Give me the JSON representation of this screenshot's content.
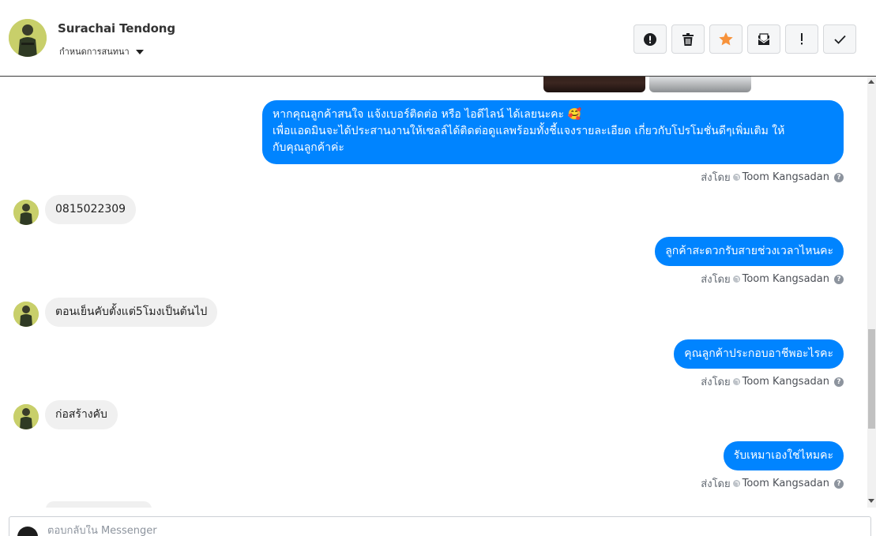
{
  "header": {
    "contact_name": "Surachai Tendong",
    "conversation_assign_label": "กำหนดการสนทนา",
    "toolbar": [
      {
        "name": "report-spam-button",
        "icon": "exclamation-circle-icon"
      },
      {
        "name": "delete-button",
        "icon": "trash-icon"
      },
      {
        "name": "star-button",
        "icon": "star-icon"
      },
      {
        "name": "archive-button",
        "icon": "archive-icon"
      },
      {
        "name": "mark-important-button",
        "icon": "exclamation-icon"
      },
      {
        "name": "mark-done-button",
        "icon": "check-icon"
      }
    ]
  },
  "messages": [
    {
      "direction": "out",
      "text_lines": [
        "หากคุณลูกค้าสนใจ แจ้งเบอร์ติดต่อ หรือ ไอดีไลน์ ได้เลยนะคะ 🥰",
        "เพื่อแอดมินจะได้ประสานงานให้เซลล์ได้ติดต่อดูแลพร้อมทั้งชี้แจงรายละเอียด เกี่ยวกับโปรโมชั่นดีๆเพิ่มเติม ให้",
        "กับคุณลูกค้าค่ะ"
      ],
      "sent_by_label": "ส่งโดย",
      "sender": "Toom Kangsadan"
    },
    {
      "direction": "in",
      "text": "0815022309"
    },
    {
      "direction": "out",
      "text": "ลูกค้าสะดวกรับสายช่วงเวลาไหนคะ",
      "sent_by_label": "ส่งโดย",
      "sender": "Toom Kangsadan"
    },
    {
      "direction": "in",
      "text": "ตอนเย็นคับตั้งแต่5โมงเป็นต้นไป"
    },
    {
      "direction": "out",
      "text": "คุณลูกค้าประกอบอาชีพอะไรคะ",
      "sent_by_label": "ส่งโดย",
      "sender": "Toom Kangsadan"
    },
    {
      "direction": "in",
      "text": "ก่อสร้างคับ"
    },
    {
      "direction": "out",
      "text": "รับเหมาเองใช่ไหมคะ",
      "sent_by_label": "ส่งโดย",
      "sender": "Toom Kangsadan"
    }
  ],
  "reply": {
    "placeholder": "ตอบกลับใน Messenger"
  },
  "colors": {
    "outgoing_bubble": "#0084ff",
    "incoming_bubble": "#f0f0f0",
    "star": "#f7923a"
  }
}
